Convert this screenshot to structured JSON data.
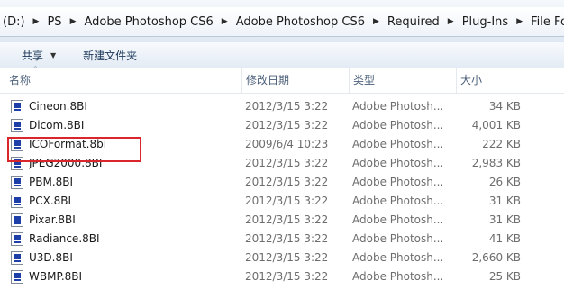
{
  "address": {
    "crumbs": [
      "(D:)",
      "PS",
      "Adobe Photoshop CS6",
      "Adobe Photoshop CS6",
      "Required",
      "Plug-Ins",
      "File Formats"
    ]
  },
  "toolbar": {
    "share_label": "共享",
    "new_folder_label": "新建文件夹"
  },
  "columns": {
    "name": "名称",
    "date": "修改日期",
    "type": "类型",
    "size": "大小"
  },
  "files": [
    {
      "name": "Cineon.8BI",
      "date": "2012/3/15 3:22",
      "type": "Adobe Photosh...",
      "size": "34 KB"
    },
    {
      "name": "Dicom.8BI",
      "date": "2012/3/15 3:22",
      "type": "Adobe Photosh...",
      "size": "4,001 KB"
    },
    {
      "name": "ICOFormat.8bi",
      "date": "2009/6/4 10:23",
      "type": "Adobe Photosh...",
      "size": "222 KB"
    },
    {
      "name": "JPEG2000.8BI",
      "date": "2012/3/15 3:22",
      "type": "Adobe Photosh...",
      "size": "2,983 KB"
    },
    {
      "name": "PBM.8BI",
      "date": "2012/3/15 3:22",
      "type": "Adobe Photosh...",
      "size": "26 KB"
    },
    {
      "name": "PCX.8BI",
      "date": "2012/3/15 3:22",
      "type": "Adobe Photosh...",
      "size": "31 KB"
    },
    {
      "name": "Pixar.8BI",
      "date": "2012/3/15 3:22",
      "type": "Adobe Photosh...",
      "size": "31 KB"
    },
    {
      "name": "Radiance.8BI",
      "date": "2012/3/15 3:22",
      "type": "Adobe Photosh...",
      "size": "41 KB"
    },
    {
      "name": "U3D.8BI",
      "date": "2012/3/15 3:22",
      "type": "Adobe Photosh...",
      "size": "2,660 KB"
    },
    {
      "name": "WBMP.8BI",
      "date": "2012/3/15 3:22",
      "type": "Adobe Photosh...",
      "size": "25 KB"
    }
  ],
  "icons": {
    "file": "photoshop-plugin-file-icon",
    "separator": "chevron-right-icon",
    "dropdown": "chevron-down-icon"
  },
  "colors": {
    "highlight_border": "#d9262d",
    "header_text": "#4c607a",
    "secondary_text": "#6d6d6d"
  }
}
